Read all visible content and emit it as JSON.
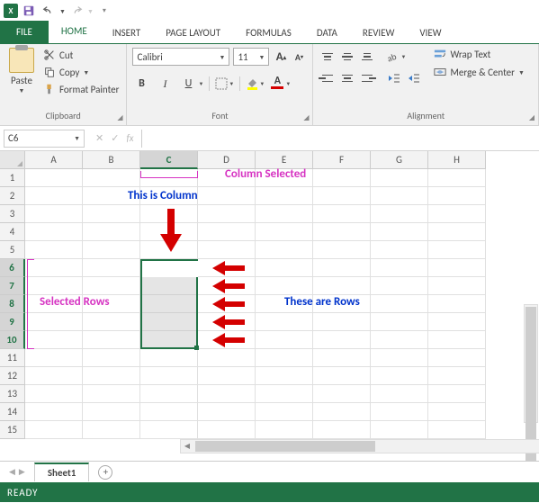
{
  "qat": {
    "app": "X"
  },
  "tabs": {
    "file": "FILE",
    "home": "HOME",
    "insert": "INSERT",
    "page_layout": "PAGE LAYOUT",
    "formulas": "FORMULAS",
    "data": "DATA",
    "review": "REVIEW",
    "view": "VIEW"
  },
  "ribbon": {
    "clipboard": {
      "paste": "Paste",
      "cut": "Cut",
      "copy": "Copy",
      "format_painter": "Format Painter",
      "label": "Clipboard"
    },
    "font": {
      "name": "Calibri",
      "size": "11",
      "bold": "B",
      "italic": "I",
      "underline": "U",
      "label": "Font"
    },
    "alignment": {
      "wrap": "Wrap Text",
      "merge": "Merge & Center",
      "label": "Alignment"
    }
  },
  "name_box": "C6",
  "fx": "fx",
  "columns": [
    "A",
    "B",
    "C",
    "D",
    "E",
    "F",
    "G",
    "H"
  ],
  "rows": [
    "1",
    "2",
    "3",
    "4",
    "5",
    "6",
    "7",
    "8",
    "9",
    "10",
    "11",
    "12",
    "13",
    "14",
    "15"
  ],
  "selected_col": "C",
  "selected_rows": [
    "6",
    "7",
    "8",
    "9",
    "10"
  ],
  "annotations": {
    "column_selected": "Column Selected",
    "this_is_column": "This is Column",
    "selected_rows": "Selected Rows",
    "these_are_rows": "These are Rows"
  },
  "sheet": {
    "name": "Sheet1"
  },
  "status": "READY"
}
